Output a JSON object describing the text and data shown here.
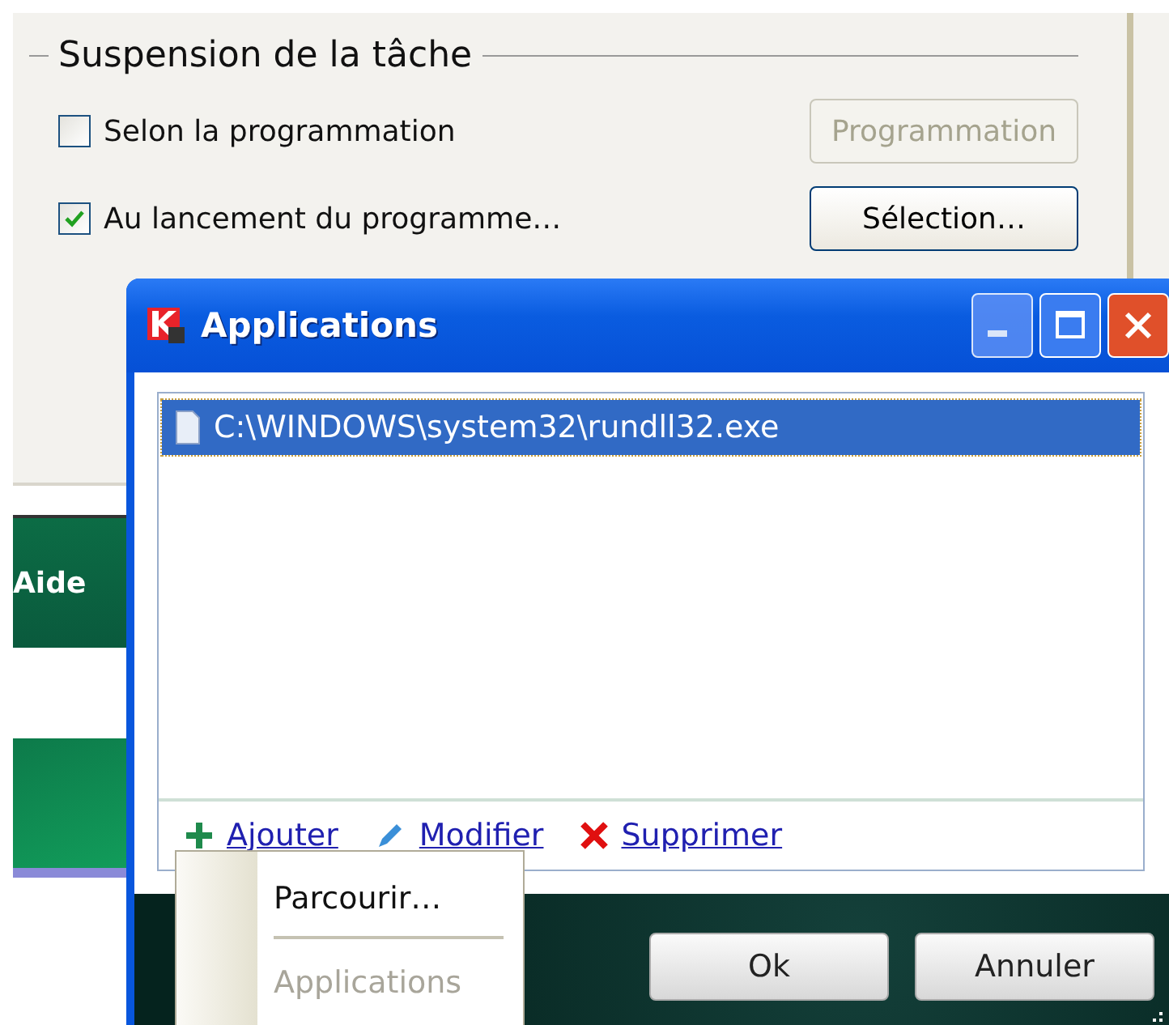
{
  "background_window": {
    "group_title": "Suspension de la tâche",
    "options": [
      {
        "label": "Selon la programmation",
        "checked": false,
        "button": {
          "label": "Programmation",
          "disabled": true
        }
      },
      {
        "label": "Au lancement du programme…",
        "checked": true,
        "button": {
          "label": "Sélection…",
          "disabled": false
        }
      }
    ],
    "menu_label": "Aide"
  },
  "dialog": {
    "title": "Applications",
    "files": [
      {
        "path": "C:\\WINDOWS\\system32\\rundll32.exe",
        "selected": true
      }
    ],
    "actions": [
      {
        "kind": "add",
        "label": "Ajouter"
      },
      {
        "kind": "edit",
        "label": "Modifier"
      },
      {
        "kind": "delete",
        "label": "Supprimer"
      }
    ],
    "buttons": [
      "Ok",
      "Annuler"
    ]
  },
  "popup_menu": {
    "items": [
      {
        "label": "Parcourir…",
        "disabled": false
      },
      {
        "label": "Applications",
        "disabled": true
      }
    ]
  }
}
